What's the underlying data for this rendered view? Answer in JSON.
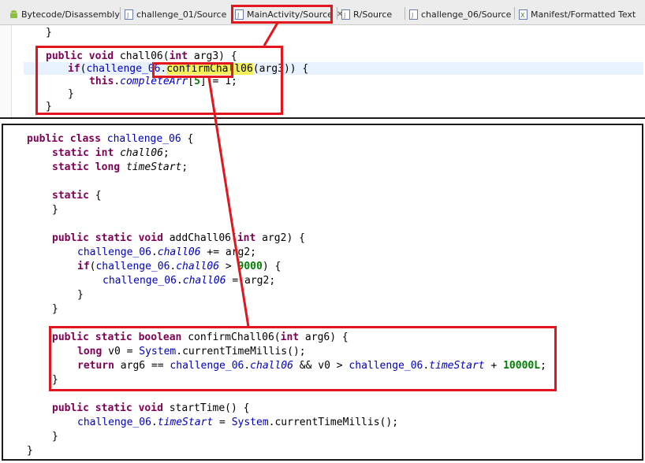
{
  "tabs": [
    {
      "label": "Bytecode/Disassembly",
      "icon": "android-icon"
    },
    {
      "label": "challenge_01/Source",
      "icon": "java-file-icon"
    },
    {
      "label": "MainActivity/Source",
      "icon": "java-file-icon",
      "active": true
    },
    {
      "label": "R/Source",
      "icon": "java-file-icon"
    },
    {
      "label": "challenge_06/Source",
      "icon": "java-file-icon"
    },
    {
      "label": "Manifest/Formatted Text",
      "icon": "xml-file-icon"
    }
  ],
  "top_code": {
    "closing_brace": "}",
    "l1": {
      "kw1": "public",
      "kw2": "void",
      "name": " chall06(",
      "kw3": "int",
      "rest": " arg3) {"
    },
    "l2": {
      "kw": "if",
      "open": "(",
      "cls": "challenge_06",
      "dot": ".",
      "method": "confirmChall06",
      "rest": "(arg3)) {"
    },
    "l3": {
      "kw": "this",
      "dot": ".",
      "field": "completeArr",
      "open": "[",
      "idx": "5",
      "rest": "] = 1;"
    },
    "l4": "}",
    "l5": "}"
  },
  "bottom_code": {
    "c1": {
      "kw1": "public",
      "kw2": "class",
      "cls": "challenge_06",
      "rest": " {"
    },
    "c2": {
      "kw1": "static",
      "kw2": "int",
      "field": "chall06",
      "rest": ";"
    },
    "c3": {
      "kw1": "static",
      "kw2": "long",
      "field": "timeStart",
      "rest": ";"
    },
    "c4": {
      "kw": "static",
      "rest": " {"
    },
    "c5": "}",
    "c6": {
      "kw1": "public",
      "kw2": "static",
      "kw3": "void",
      "name": " addChall06(",
      "kw4": "int",
      "rest": " arg2) {"
    },
    "c7": {
      "cls": "challenge_06",
      "dot": ".",
      "field": "chall06",
      "rest": " += arg2;"
    },
    "c8": {
      "kw": "if",
      "open": "(",
      "cls": "challenge_06",
      "dot": ".",
      "field": "chall06",
      "op": " > ",
      "num": "9000",
      "rest": ") {"
    },
    "c9": {
      "cls": "challenge_06",
      "dot": ".",
      "field": "chall06",
      "rest": " = arg2;"
    },
    "c10": "}",
    "c11": "}",
    "c12": {
      "kw1": "public",
      "kw2": "static",
      "kw3": "boolean",
      "name": " confirmChall06(",
      "kw4": "int",
      "rest": " arg6) {"
    },
    "c13": {
      "kw": "long",
      "mid": " v0 = ",
      "cls": "System",
      "rest": ".currentTimeMillis();"
    },
    "c14": {
      "kw": "return",
      "mid": " arg6 == ",
      "cls": "challenge_06",
      "dot": ".",
      "field": "chall06",
      "mid2": " && v0 > ",
      "cls2": "challenge_06",
      "dot2": ".",
      "field2": "timeStart",
      "mid3": " + ",
      "num": "10000L",
      "end": ";"
    },
    "c15": "}",
    "c16": {
      "kw1": "public",
      "kw2": "static",
      "kw3": "void",
      "name": " startTime() {"
    },
    "c17": {
      "cls": "challenge_06",
      "dot": ".",
      "field": "timeStart",
      "mid": " = ",
      "cls2": "System",
      "rest": ".currentTimeMillis();"
    },
    "c18": "}",
    "c19": "}"
  },
  "colors": {
    "annotation": "#e3151d",
    "keyword": "#7f0055",
    "identifier": "#0000c0",
    "number": "#008000",
    "highlight": "#f4f05a"
  }
}
